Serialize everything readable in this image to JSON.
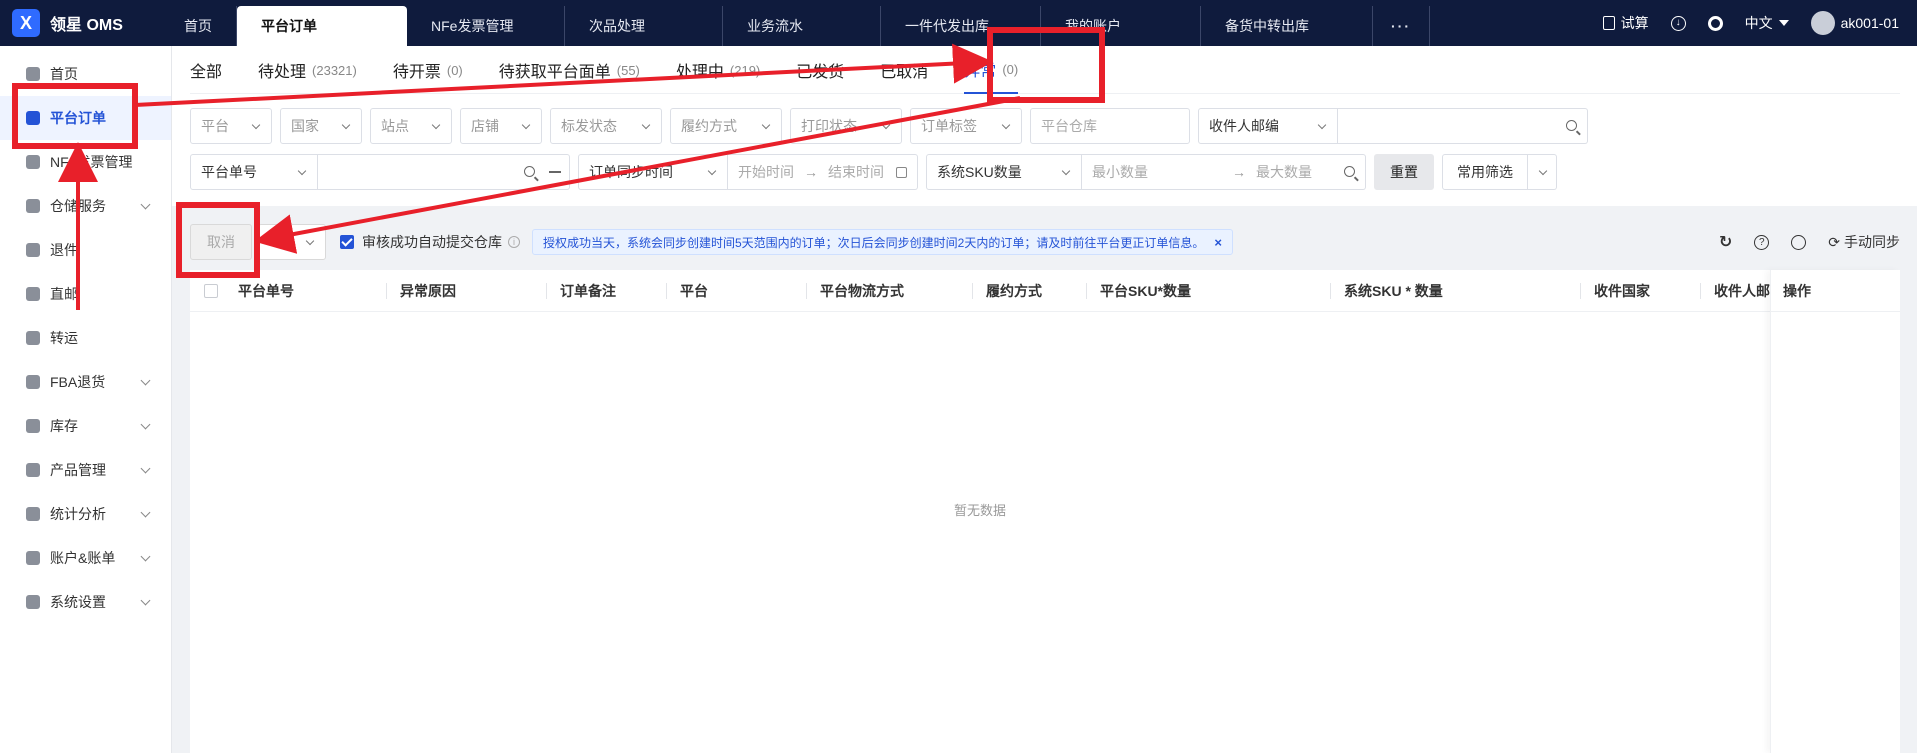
{
  "brand": {
    "name": "领星 OMS",
    "mark": "X"
  },
  "top_tabs": [
    {
      "label": "首页"
    },
    {
      "label": "平台订单"
    },
    {
      "label": "NFe发票管理"
    },
    {
      "label": "次品处理"
    },
    {
      "label": "业务流水"
    },
    {
      "label": "一件代发出库"
    },
    {
      "label": "我的账户"
    },
    {
      "label": "备货中转出库"
    }
  ],
  "top_more": "···",
  "top_right": {
    "trial": "试算",
    "language": "中文",
    "user": "ak001-01"
  },
  "sidebar": {
    "items": [
      {
        "label": "首页"
      },
      {
        "label": "平台订单"
      },
      {
        "label": "NFe发票管理"
      },
      {
        "label": "仓储服务"
      },
      {
        "label": "退件"
      },
      {
        "label": "直邮"
      },
      {
        "label": "转运"
      },
      {
        "label": "FBA退货"
      },
      {
        "label": "库存"
      },
      {
        "label": "产品管理"
      },
      {
        "label": "统计分析"
      },
      {
        "label": "账户&账单"
      },
      {
        "label": "系统设置"
      }
    ]
  },
  "sub_tabs": [
    {
      "label": "全部",
      "count": ""
    },
    {
      "label": "待处理",
      "count": "(23321)"
    },
    {
      "label": "待开票",
      "count": "(0)"
    },
    {
      "label": "待获取平台面单",
      "count": "(55)"
    },
    {
      "label": "处理中",
      "count": "(219)"
    },
    {
      "label": "已发货",
      "count": ""
    },
    {
      "label": "已取消",
      "count": ""
    },
    {
      "label": "异常",
      "count": "(0)"
    }
  ],
  "filters": {
    "row1": {
      "platform": "平台",
      "country": "国家",
      "site": "站点",
      "shop": "店铺",
      "ship_status": "标发状态",
      "fulfill_method": "履约方式",
      "print_status": "打印状态",
      "order_tag": "订单标签",
      "platform_warehouse": "平台仓库",
      "recipient_zip": "收件人邮编"
    },
    "row2": {
      "order_no": "平台单号",
      "sync_time": "订单同步时间",
      "start_time": "开始时间",
      "end_time": "结束时间",
      "sku_qty": "系统SKU数量",
      "min_qty": "最小数量",
      "max_qty": "最大数量",
      "reset": "重置",
      "common_filter": "常用筛选"
    }
  },
  "toolbar": {
    "cancel": "取消",
    "auto_submit": "审核成功自动提交仓库",
    "notice": "授权成功当天，系统会同步创建时间5天范围内的订单；次日后会同步创建时间2天内的订单；请及时前往平台更正订单信息。",
    "notice_close": "×",
    "manual_sync": "手动同步"
  },
  "table": {
    "columns": [
      "平台单号",
      "异常原因",
      "订单备注",
      "平台",
      "平台物流方式",
      "履约方式",
      "平台SKU*数量",
      "系统SKU * 数量",
      "收件国家",
      "收件人邮"
    ],
    "op_column": "操作",
    "empty_text": "暂无数据"
  },
  "colors": {
    "nav_bg": "#0f1b3d",
    "accent": "#2453d6",
    "annotation": "#e8202a"
  }
}
